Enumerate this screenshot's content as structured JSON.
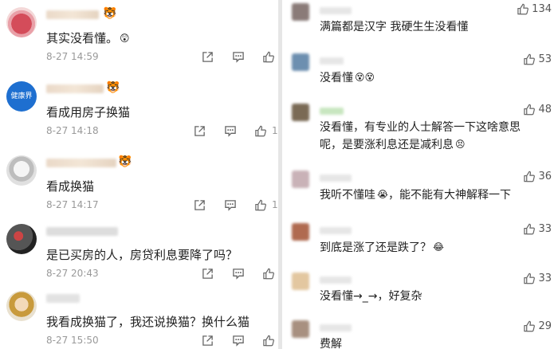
{
  "left_comments": [
    {
      "text": "其实没看懂。",
      "emoji": "😲",
      "time": "8-27 14:59",
      "reply_count": ""
    },
    {
      "text": "看成用房子换猫",
      "emoji": "",
      "time": "8-27 14:18",
      "reply_count": "1",
      "avatar_label": "健康界"
    },
    {
      "text": "看成换猫",
      "emoji": "",
      "time": "8-27 14:17",
      "reply_count": "1"
    },
    {
      "text": "是已买房的人，房贷利息要降了吗？",
      "emoji": "",
      "time": "8-27 20:43",
      "reply_count": ""
    },
    {
      "text": "我看成换猫了，我还说换猫？换什么猫",
      "emoji": "",
      "time": "8-27 15:50",
      "reply_count": ""
    }
  ],
  "right_comments": [
    {
      "lines": [
        "满篇都是汉字 我硬生生没看懂"
      ],
      "emoji": "",
      "likes": "134"
    },
    {
      "lines": [
        "没看懂"
      ],
      "emoji": "😵😵",
      "likes": "53"
    },
    {
      "lines": [
        "没看懂，有专业的人士解答一下这啥意思",
        "呢，是要涨利息还是减利息"
      ],
      "emoji": "😣",
      "likes": "48"
    },
    {
      "lines": [
        "我听不懂哇",
        "，能不能有大神解释一下"
      ],
      "emoji": "😭",
      "likes": "36"
    },
    {
      "lines": [
        "到底是涨了还是跌了？"
      ],
      "emoji": "😂",
      "likes": "33"
    },
    {
      "lines": [
        "没看懂→_→，好复杂"
      ],
      "emoji": "",
      "likes": "33"
    },
    {
      "lines": [
        "费解"
      ],
      "emoji": "",
      "likes": "29"
    }
  ],
  "icons": {
    "share": "share-icon",
    "comment": "comment-icon",
    "like": "thumbs-up-icon"
  }
}
